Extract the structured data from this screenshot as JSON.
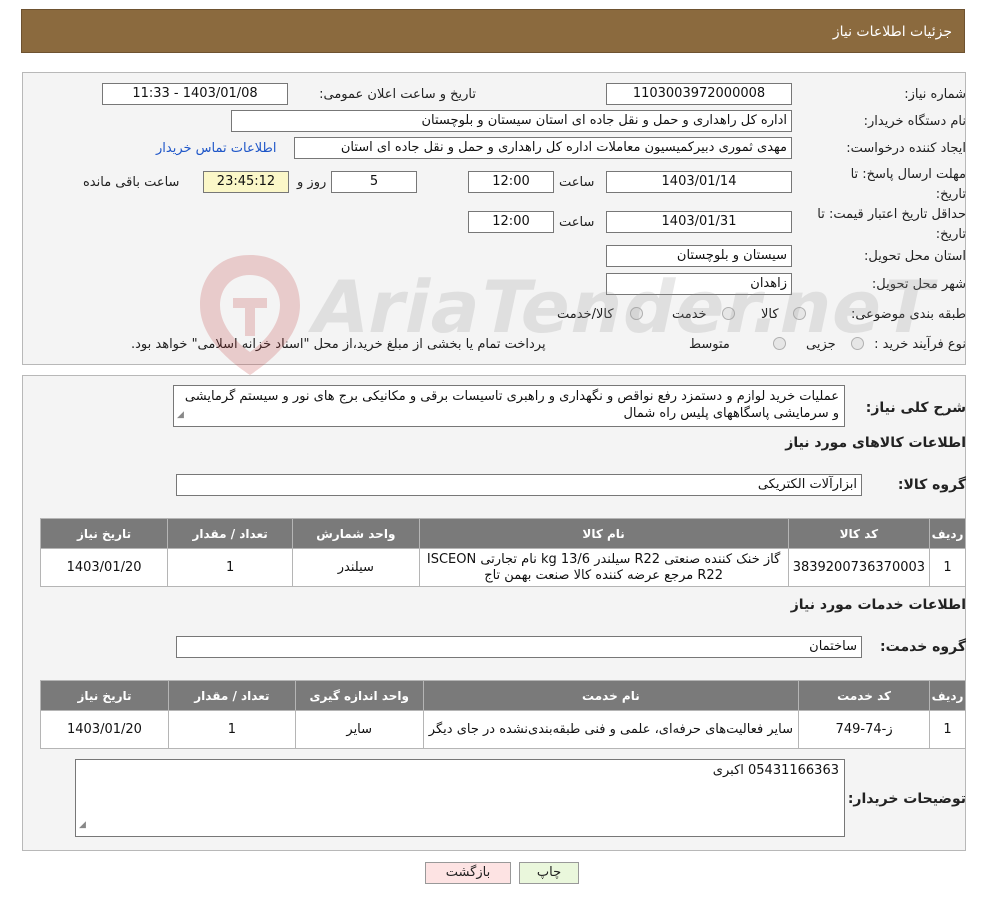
{
  "header": {
    "title": "جزئیات اطلاعات نیاز"
  },
  "form": {
    "need_number_label": "شماره نیاز:",
    "need_number": "1103003972000008",
    "announce_label": "تاریخ و ساعت اعلان عمومی:",
    "announce_value": "1403/01/08 - 11:33",
    "buyer_org_label": "نام دستگاه خریدار:",
    "buyer_org": "اداره کل راهداری و حمل و نقل جاده ای استان سیستان و بلوچستان",
    "creator_label": "ایجاد کننده درخواست:",
    "creator": "مهدی ثموری دبیرکمیسیون معاملات اداره کل راهداری و حمل و نقل جاده ای استان",
    "contact_link": "اطلاعات تماس خریدار",
    "deadline_label_1": "مهلت ارسال پاسخ: تا",
    "deadline_label_2": "تاریخ:",
    "deadline_date": "1403/01/14",
    "time_label": "ساعت",
    "deadline_time": "12:00",
    "days_value": "5",
    "days_label": "روز و",
    "remaining_value": "23:45:12",
    "remaining_label": "ساعت باقی مانده",
    "validity_label_1": "حداقل تاریخ اعتبار قیمت: تا",
    "validity_label_2": "تاریخ:",
    "validity_date": "1403/01/31",
    "validity_time": "12:00",
    "province_label": "استان محل تحویل:",
    "province": "سیستان و بلوچستان",
    "city_label": "شهر محل تحویل:",
    "city": "زاهدان",
    "category_label": "طبقه بندی موضوعی:",
    "category_options": [
      "کالا",
      "خدمت",
      "کالا/خدمت"
    ],
    "process_label": "نوع فرآیند خرید :",
    "process_options": [
      "جزیی",
      "متوسط"
    ],
    "process_note": "پرداخت تمام یا بخشی از مبلغ خرید،از محل \"اسناد خزانه اسلامی\" خواهد بود."
  },
  "description": {
    "label": "شرح کلی نیاز:",
    "text": "عملیات خرید لوازم و دستمزد رفع نواقص و نگهداری و راهبری تاسیسات برقی و مکانیکی برج های نور و سیستم گرمایشی و سرمایشی پاسگاههای پلیس راه شمال"
  },
  "goods": {
    "section_title": "اطلاعات کالاهای مورد نیاز",
    "group_label": "گروه کالا:",
    "group_value": "ابزارآلات الکتریکی",
    "columns": [
      "ردیف",
      "کد کالا",
      "نام کالا",
      "واحد شمارش",
      "تعداد / مقدار",
      "تاریخ نیاز"
    ],
    "rows": [
      [
        "1",
        "3839200736370003",
        "گاز خنک کننده صنعتی R22 سیلندر 13/6 kg نام تجارتی ISCEON R22 مرجع عرضه کننده کالا صنعت بهمن تاج",
        "سیلندر",
        "1",
        "1403/01/20"
      ]
    ]
  },
  "services": {
    "section_title": "اطلاعات خدمات مورد نیاز",
    "group_label": "گروه خدمت:",
    "group_value": "ساختمان",
    "columns": [
      "ردیف",
      "کد خدمت",
      "نام خدمت",
      "واحد اندازه گیری",
      "تعداد / مقدار",
      "تاریخ نیاز"
    ],
    "rows": [
      [
        "1",
        "ز-74-749",
        "سایر فعالیت‌های حرفه‌ای، علمی و فنی طبقه‌بندی‌نشده در جای دیگر",
        "سایر",
        "1",
        "1403/01/20"
      ]
    ]
  },
  "buyer_notes": {
    "label": "توضیحات خریدار:",
    "text": "05431166363 اکبری"
  },
  "buttons": {
    "print": "چاپ",
    "back": "بازگشت"
  },
  "watermark_text": "AriaTender.neT",
  "colors": {
    "header_bg": "#8b6a3e",
    "table_header": "#7a7a7a",
    "back_button": "#fde3e3",
    "print_button": "#eaf7dc",
    "link": "#1e56c8"
  }
}
